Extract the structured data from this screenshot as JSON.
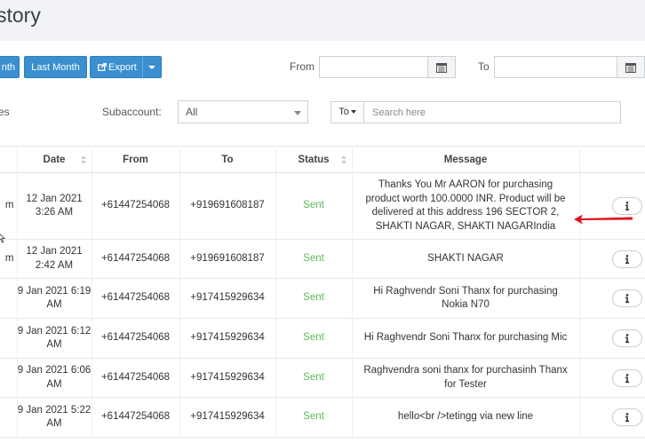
{
  "page": {
    "title": "story"
  },
  "toolbar": {
    "month_label": "nth",
    "last_month_label": "Last Month",
    "export_label": "Export",
    "from_label": "From",
    "to_label": "To",
    "from_value": "",
    "to_value": ""
  },
  "filters": {
    "left_label": "es",
    "subaccount_label": "Subaccount:",
    "subaccount_value": "All",
    "direction_value": "To",
    "search_placeholder": "Search here"
  },
  "table": {
    "columns": [
      "",
      "Date",
      "From",
      "To",
      "Status",
      "Message",
      ""
    ],
    "rows": [
      {
        "first": "m",
        "date": "12 Jan 2021 3:26 AM",
        "from": "+61447254068",
        "to": "+919691608187",
        "status": "Sent",
        "message": "Thanks You Mr AARON for purchasing product worth 100.0000 INR. Product will be delivered at this address 196 SECTOR 2, SHAKTI NAGAR, SHAKTI NAGARIndia"
      },
      {
        "first": "m",
        "date": "12 Jan 2021 2:42 AM",
        "from": "+61447254068",
        "to": "+919691608187",
        "status": "Sent",
        "message": "SHAKTI NAGAR"
      },
      {
        "first": "",
        "date": "9 Jan 2021 6:19 AM",
        "from": "+61447254068",
        "to": "+917415929634",
        "status": "Sent",
        "message": "Hi Raghvendr Soni Thanx for purchasing Nokia N70"
      },
      {
        "first": "",
        "date": "9 Jan 2021 6:12 AM",
        "from": "+61447254068",
        "to": "+917415929634",
        "status": "Sent",
        "message": "Hi Raghvendr Soni Thanx for purchasing Mic"
      },
      {
        "first": "",
        "date": "9 Jan 2021 6:06 AM",
        "from": "+61447254068",
        "to": "+917415929634",
        "status": "Sent",
        "message": "Raghvendra soni thanx for purchasinh Thanx for Tester"
      },
      {
        "first": "",
        "date": "9 Jan 2021 5:22 AM",
        "from": "+61447254068",
        "to": "+917415929634",
        "status": "Sent",
        "message": "hello<br />tetingg via new line"
      }
    ]
  },
  "colors": {
    "accent": "#3a8fcf",
    "sent": "#5cb85c",
    "annotation": "#e3131b"
  },
  "icons": {
    "export": "share-square-icon",
    "calendar": "calendar-icon",
    "info": "info-icon"
  }
}
